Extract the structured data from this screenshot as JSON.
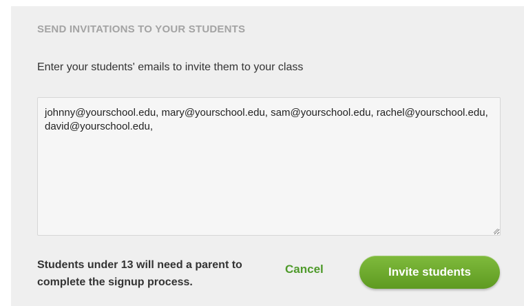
{
  "dialog": {
    "title": "SEND INVITATIONS TO YOUR STUDENTS",
    "instructions": "Enter your students' emails to invite them to your class",
    "emails_value": "johnny@yourschool.edu, mary@yourschool.edu, sam@yourschool.edu, rachel@yourschool.edu, david@yourschool.edu,",
    "notice": "Students under 13 will need a parent to complete the signup process.",
    "cancel_label": "Cancel",
    "invite_label": "Invite students"
  },
  "colors": {
    "panel_background": "#efefef",
    "title_gray": "#a3a3a3",
    "accent_green": "#4e9a2a",
    "button_green_top": "#7fba3c",
    "button_green_bottom": "#5e9a21"
  }
}
